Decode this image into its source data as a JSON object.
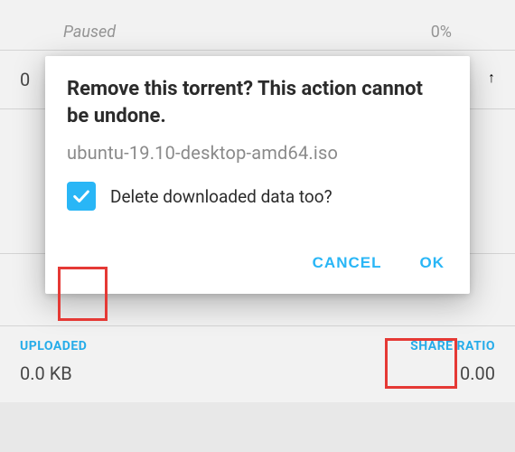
{
  "bg": {
    "status": "Paused",
    "percent": "0%",
    "side_left_char": "0",
    "stats": {
      "uploaded_label": "UPLOADED",
      "uploaded_value": "0.0 KB",
      "ratio_label": "SHARE RATIO",
      "ratio_value": "0.00"
    }
  },
  "dialog": {
    "title": "Remove this torrent? This action cannot be undone.",
    "torrent_name": "ubuntu-19.10-desktop-amd64.iso",
    "checkbox_label": "Delete downloaded data too?",
    "checkbox_checked": true,
    "actions": {
      "cancel": "CANCEL",
      "ok": "OK"
    }
  }
}
